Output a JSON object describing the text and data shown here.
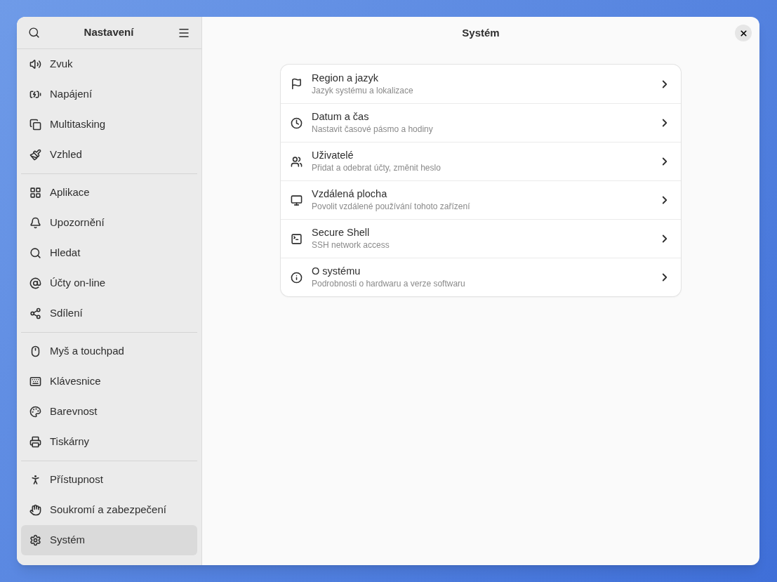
{
  "sidebar": {
    "title": "Nastavení",
    "groups": [
      {
        "items": [
          {
            "label": "Zvuk",
            "selected": false
          },
          {
            "label": "Napájení",
            "selected": false
          },
          {
            "label": "Multitasking",
            "selected": false
          },
          {
            "label": "Vzhled",
            "selected": false
          }
        ]
      },
      {
        "items": [
          {
            "label": "Aplikace",
            "selected": false
          },
          {
            "label": "Upozornění",
            "selected": false
          },
          {
            "label": "Hledat",
            "selected": false
          },
          {
            "label": "Účty on-line",
            "selected": false
          },
          {
            "label": "Sdílení",
            "selected": false
          }
        ]
      },
      {
        "items": [
          {
            "label": "Myš a touchpad",
            "selected": false
          },
          {
            "label": "Klávesnice",
            "selected": false
          },
          {
            "label": "Barevnost",
            "selected": false
          },
          {
            "label": "Tiskárny",
            "selected": false
          }
        ]
      },
      {
        "items": [
          {
            "label": "Přístupnost",
            "selected": false
          },
          {
            "label": "Soukromí a zabezpečení",
            "selected": false
          },
          {
            "label": "Systém",
            "selected": true
          }
        ]
      }
    ]
  },
  "main": {
    "title": "Systém",
    "rows": [
      {
        "title": "Region a jazyk",
        "subtitle": "Jazyk systému a lokalizace"
      },
      {
        "title": "Datum a čas",
        "subtitle": "Nastavit časové pásmo a hodiny"
      },
      {
        "title": "Uživatelé",
        "subtitle": "Přidat a odebrat účty, změnit heslo"
      },
      {
        "title": "Vzdálená plocha",
        "subtitle": "Povolit vzdálené používání tohoto zařízení"
      },
      {
        "title": "Secure Shell",
        "subtitle": "SSH network access"
      },
      {
        "title": "O systému",
        "subtitle": "Podrobnosti o hardwaru a verze softwaru"
      }
    ]
  }
}
